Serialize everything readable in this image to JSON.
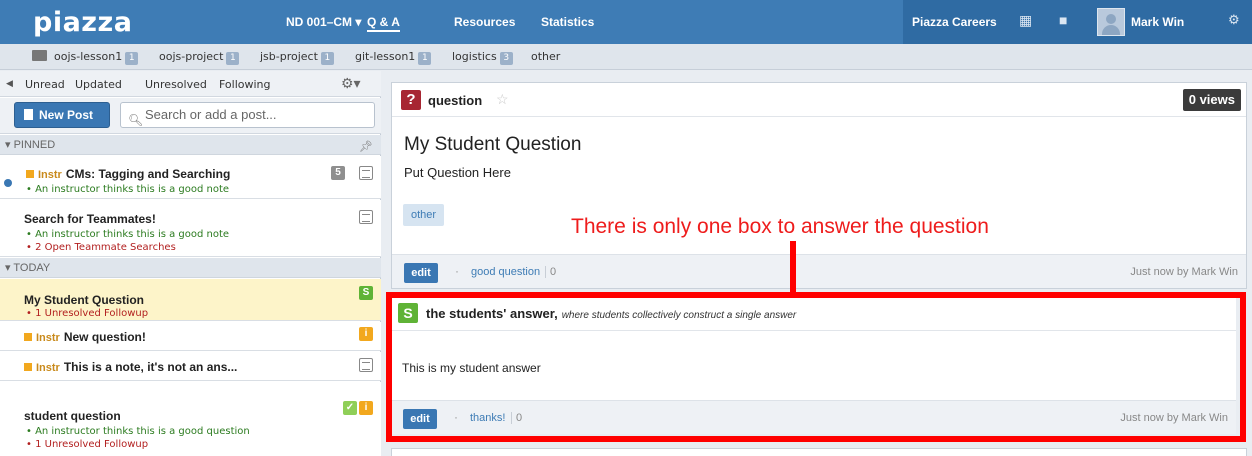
{
  "topbar": {
    "logo": "piazza",
    "course": "ND 001–CM",
    "course_caret": "▾",
    "nav": [
      "Q & A",
      "Resources",
      "Statistics"
    ],
    "careers": "Piazza Careers",
    "user": "Mark Win",
    "icons": [
      "calendar-icon",
      "chat-icon",
      "avatar",
      "gear-icon"
    ]
  },
  "folders": [
    {
      "label": "oojs-lesson1",
      "count": "1"
    },
    {
      "label": "oojs-project",
      "count": "1"
    },
    {
      "label": "jsb-project",
      "count": "1"
    },
    {
      "label": "git-lesson1",
      "count": "1"
    },
    {
      "label": "logistics",
      "count": "3"
    },
    {
      "label": "other",
      "count": ""
    }
  ],
  "filters": [
    "Unread",
    "Updated",
    "Unresolved",
    "Following"
  ],
  "new_post": "New Post",
  "search_placeholder": "Search or add a post...",
  "sections": {
    "pinned": "▾ PINNED",
    "today": "▾ TODAY"
  },
  "posts": [
    {
      "instr": "Instr",
      "title": "CMs: Tagging and Searching",
      "notes": [
        "• An instructor thinks this is a good note"
      ],
      "badge": "5"
    },
    {
      "title": "Search for Teammates!",
      "notes": [
        "• An instructor thinks this is a good note",
        "• 2 Open Teammate Searches"
      ]
    },
    {
      "title": "My Student Question",
      "notes": [
        "• 1 Unresolved Followup"
      ],
      "badge": "S"
    },
    {
      "instr": "Instr",
      "title": "New question!",
      "badge": "i"
    },
    {
      "instr": "Instr",
      "title": "This is a note, it's not an ans..."
    },
    {
      "title": "student question",
      "notes": [
        "• An instructor thinks this is a good question",
        "• 1 Unresolved Followup"
      ],
      "badge": "i"
    }
  ],
  "question": {
    "type": "question",
    "views": "0 views",
    "title": "My Student Question",
    "body": "Put Question Here",
    "tag": "other",
    "edit": "edit",
    "action": "good question",
    "count": "0",
    "when": "Just now by Mark Win"
  },
  "answer": {
    "icon": "S",
    "label": "the students' answer,",
    "sublabel": "where students collectively construct a single answer",
    "body": "This is my student answer",
    "edit": "edit",
    "action": "thanks!",
    "count": "0",
    "when": "Just now by Mark Win"
  },
  "annotation": "There is only one box to answer the question",
  "colors": {
    "nav": "#3e7cb5",
    "annotation": "#ff0000",
    "student": "#5fb336",
    "question": "#a72632"
  }
}
